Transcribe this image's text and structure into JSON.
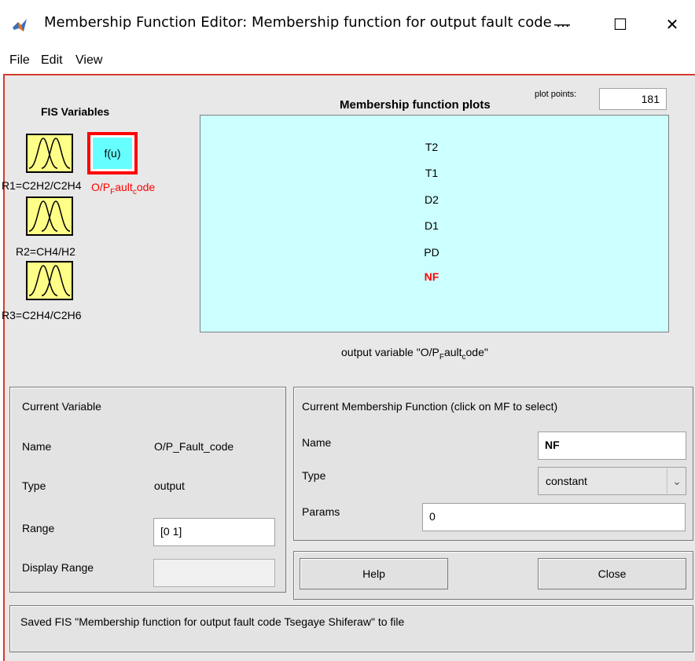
{
  "window": {
    "title": "Membership Function Editor: Membership function for output fault code ...",
    "minimize_symbol": "—",
    "maximize_symbol": "☐",
    "close_symbol": "✕"
  },
  "menu": [
    "File",
    "Edit",
    "View"
  ],
  "fis": {
    "heading": "FIS Variables",
    "inputs": [
      {
        "label": "R1=C2H2/C2H4",
        "icon": "gaussian-mf-icon"
      },
      {
        "label": "R2=CH4/H2",
        "icon": "gaussian-mf-icon"
      },
      {
        "label": "R3=C2H4/C2H6",
        "icon": "gaussian-mf-icon"
      }
    ],
    "output": {
      "box_text": "f(u)",
      "label_parts": [
        "O/P",
        "F",
        "ault",
        "c",
        "ode"
      ]
    }
  },
  "plot": {
    "heading": "Membership function plots",
    "plot_points_label": "plot points:",
    "plot_points": "181",
    "mf_labels": [
      "T2",
      "T1",
      "D2",
      "D1",
      "PD",
      "NF"
    ],
    "selected_mf": "NF",
    "caption_parts": [
      "output variable \"O/P",
      "F",
      "ault",
      "c",
      "ode\""
    ]
  },
  "current_variable": {
    "title": "Current Variable",
    "name_label": "Name",
    "name_value": "O/P_Fault_code",
    "type_label": "Type",
    "type_value": "output",
    "range_label": "Range",
    "range_value": "[0 1]",
    "display_range_label": "Display Range",
    "display_range_value": ""
  },
  "current_mf": {
    "title": "Current Membership Function (click on MF to select)",
    "name_label": "Name",
    "name_value": "NF",
    "type_label": "Type",
    "type_value": "constant",
    "params_label": "Params",
    "params_value": "0"
  },
  "buttons": {
    "help": "Help",
    "close": "Close"
  },
  "status": "Saved FIS \"Membership function for output fault code Tsegaye Shiferaw\" to file",
  "colors": {
    "accent_border": "#d73a2f",
    "input_box": "#ffff88",
    "output_box": "#66ffff",
    "plot_bg": "#ccffff",
    "selected_mf": "#ff0000"
  }
}
